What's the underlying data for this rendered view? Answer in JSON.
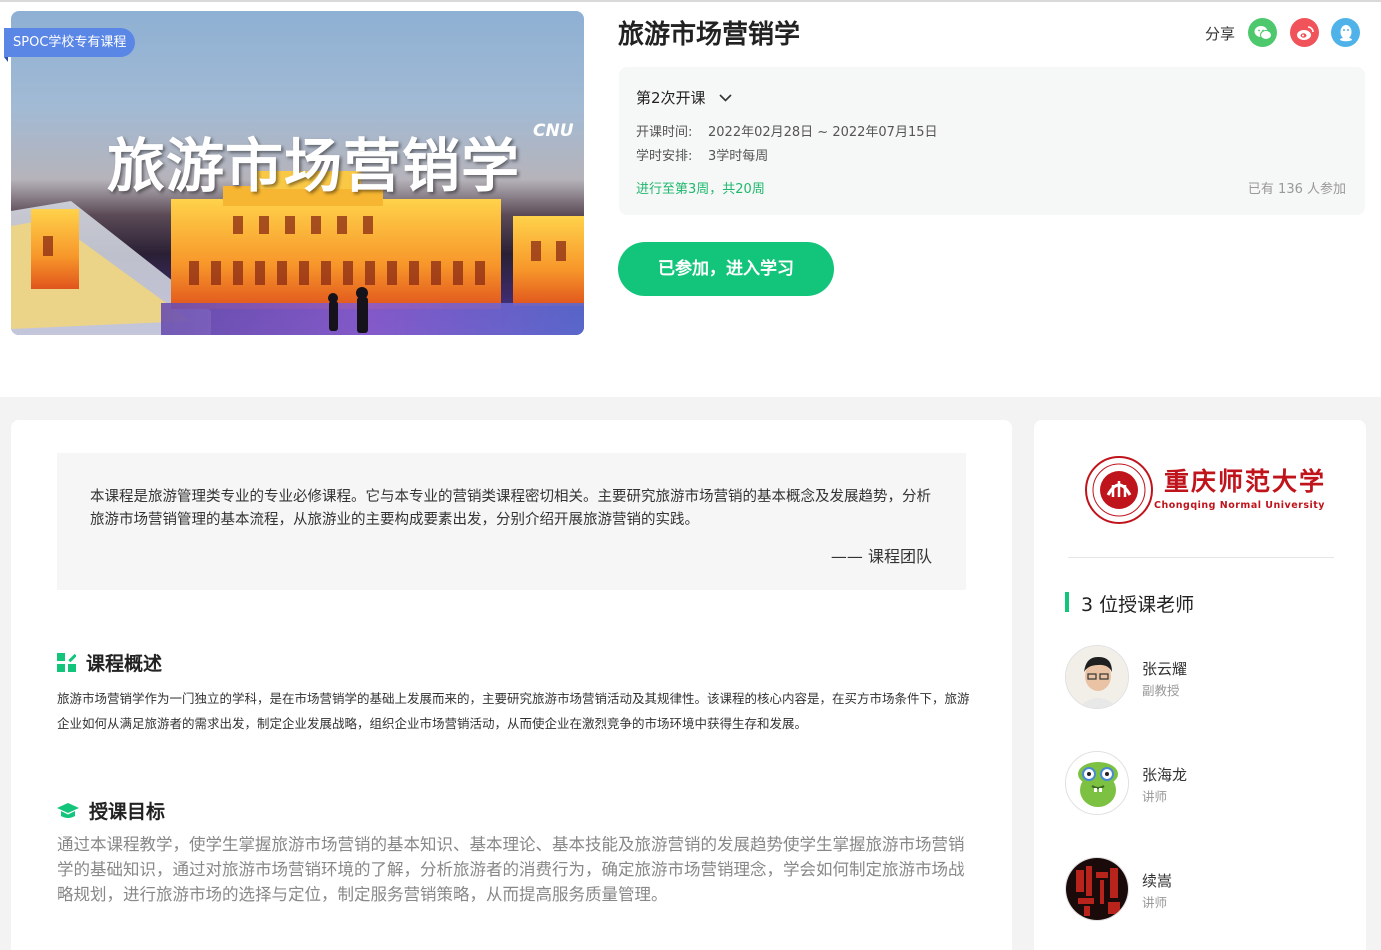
{
  "cover": {
    "badge": "SPOC学校专有课程",
    "title_art": "旅游市场营销学",
    "tag_art": "CNU"
  },
  "course": {
    "title": "旅游市场营销学",
    "share_label": "分享",
    "share_icons": [
      "wechat-icon",
      "weibo-icon",
      "qq-icon"
    ],
    "session": "第2次开课",
    "start_label": "开课时间:",
    "start_value": "2022年02月28日 ~ 2022年07月15日",
    "hours_label": "学时安排:",
    "hours_value": "3学时每周",
    "progress": "进行至第3周，共20周",
    "joined": "已有 136 人参加",
    "enter_button": "已参加，进入学习"
  },
  "intro": {
    "quote": "本课程是旅游管理类专业的专业必修课程。它与本专业的营销类课程密切相关。主要研究旅游市场营销的基本概念及发展趋势，分析旅游市场营销管理的基本流程，从旅游业的主要构成要素出发，分别介绍开展旅游营销的实践。",
    "author": "—— 课程团队"
  },
  "overview": {
    "heading": "课程概述",
    "text": "旅游市场营销学作为一门独立的学科，是在市场营销学的基础上发展而来的，主要研究旅游市场营销活动及其规律性。该课程的核心内容是，在买方市场条件下，旅游企业如何从满足旅游者的需求出发，制定企业发展战略，组织企业市场营销活动，从而使企业在激烈竞争的市场环境中获得生存和发展。"
  },
  "goals": {
    "heading": "授课目标",
    "text": "通过本课程教学，使学生掌握旅游市场营销的基本知识、基本理论、基本技能及旅游营销的发展趋势使学生掌握旅游市场营销学的基础知识，通过对旅游市场营销环境的了解，分析旅游者的消费行为，确定旅游市场营销理念，学会如何制定旅游市场战略规划，进行旅游市场的选择与定位，制定服务营销策略，从而提高服务质量管理。"
  },
  "school": {
    "name_cn": "重庆师范大学",
    "name_en": "Chongqing Normal University"
  },
  "teachers": {
    "count_label": "3 位授课老师",
    "list": [
      {
        "name": "张云耀",
        "title": "副教授"
      },
      {
        "name": "张海龙",
        "title": "讲师"
      },
      {
        "name": "续嵩",
        "title": "讲师"
      }
    ]
  },
  "colors": {
    "accent": "#13c57a",
    "badge": "#5a86e6",
    "school_red": "#c0141c"
  }
}
